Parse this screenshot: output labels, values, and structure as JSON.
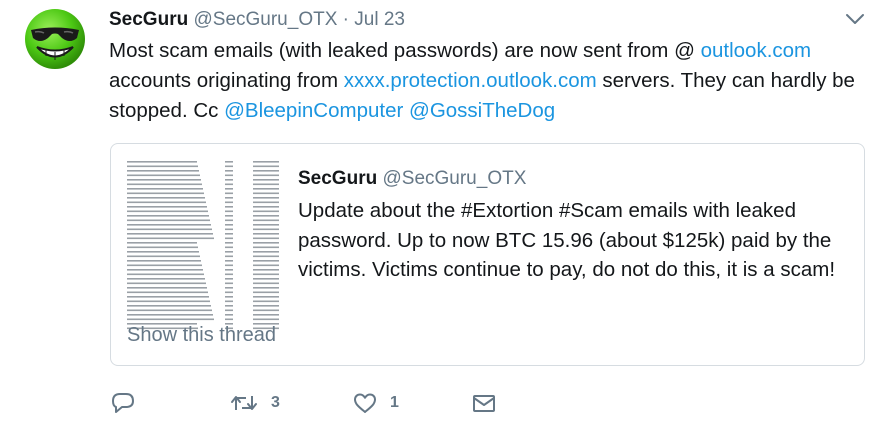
{
  "tweet": {
    "display_name": "SecGuru",
    "handle": "@SecGuru_OTX",
    "separator": "·",
    "date": "Jul 23",
    "text": {
      "part1": "Most scam emails (with leaked passwords) are now sent from @ ",
      "link1": "outlook.com",
      "part2": " accounts originating from ",
      "link2": "xxxx.protection.outlook.com",
      "part3": " servers. They can hardly be stopped. Cc ",
      "mention1": "@BleepinComputer",
      "space": " ",
      "mention2": "@GossiTheDog"
    }
  },
  "quoted": {
    "display_name": "SecGuru",
    "handle": "@SecGuru_OTX",
    "text": "Update about the #Extortion #Scam emails with leaked password. Up to now BTC 15.96 (about $125k) paid by the victims. Victims continue to pay, do not do this, it is a scam!",
    "show_thread": "Show this thread"
  },
  "actions": {
    "reply": {
      "icon": "reply-icon",
      "count": ""
    },
    "retweet": {
      "icon": "retweet-icon",
      "count": "3"
    },
    "like": {
      "icon": "heart-icon",
      "count": "1"
    },
    "message": {
      "icon": "envelope-icon",
      "count": ""
    }
  },
  "colors": {
    "link": "#1b95e0",
    "secondary_text": "#657786",
    "primary_text": "#14171a",
    "border": "#d6dce1",
    "avatar_green": "#5ed41c"
  }
}
